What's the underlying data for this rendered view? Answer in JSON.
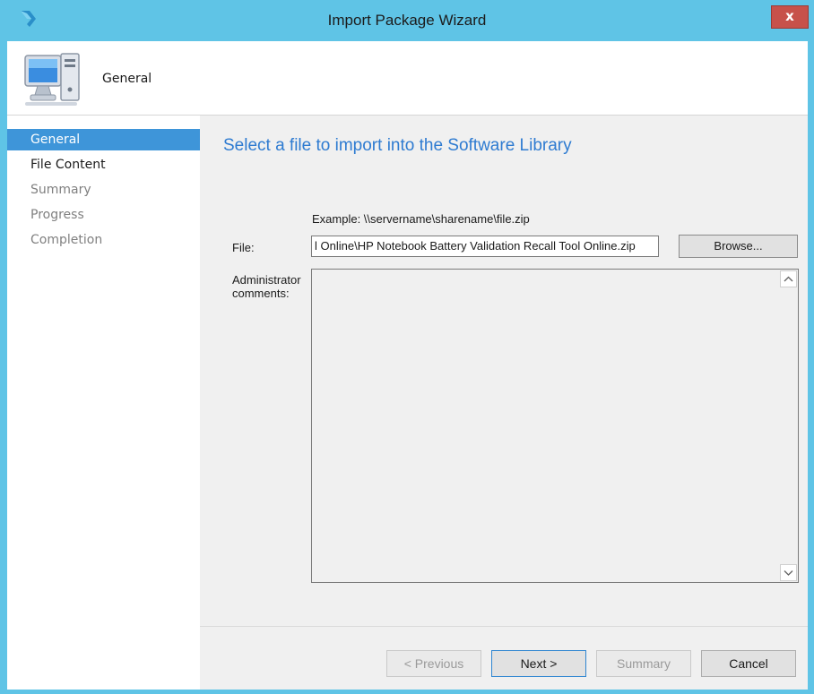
{
  "window": {
    "title": "Import Package Wizard",
    "close_label": "x"
  },
  "header": {
    "title": "General"
  },
  "sidebar": {
    "items": [
      {
        "label": "General",
        "state": "active"
      },
      {
        "label": "File Content",
        "state": "enabled"
      },
      {
        "label": "Summary",
        "state": "disabled"
      },
      {
        "label": "Progress",
        "state": "disabled"
      },
      {
        "label": "Completion",
        "state": "disabled"
      }
    ]
  },
  "main": {
    "heading": "Select a file to import into the Software Library",
    "example_text": "Example: \\\\servername\\sharename\\file.zip",
    "file_label": "File:",
    "file_value": "l Online\\HP Notebook Battery Validation Recall Tool Online.zip",
    "browse_label": "Browse...",
    "admin_label_line1": "Administrator",
    "admin_label_line2": "comments:",
    "comments_value": ""
  },
  "footer": {
    "previous_label": "< Previous",
    "next_label": "Next >",
    "summary_label": "Summary",
    "cancel_label": "Cancel"
  },
  "colors": {
    "title_bar": "#5fc4e6",
    "accent": "#3e95d9",
    "heading": "#2e7bd1",
    "close": "#c7514a"
  },
  "icons": {
    "app": "wizard-arrow-icon",
    "header": "computer-icon"
  }
}
